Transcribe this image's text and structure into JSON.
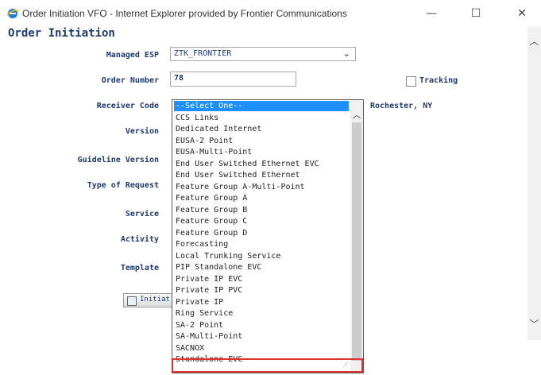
{
  "window": {
    "title": "Order Initiation VFO - Internet Explorer provided by Frontier Communications",
    "minimize": "—",
    "maximize": "☐",
    "close": "✕"
  },
  "page": {
    "heading": "Order Initiation"
  },
  "form": {
    "labels": {
      "managed_esp": "Managed ESP",
      "order_number": "Order Number",
      "receiver_code": "Receiver Code",
      "version": "Version",
      "guideline_version": "Guideline Version",
      "type_of_request": "Type of Request",
      "service": "Service",
      "activity": "Activity",
      "template": "Template"
    },
    "managed_esp_value": "ZTK_FRONTIER",
    "order_number_value": "78",
    "tracking_label": "Tracking",
    "receiver_location": "Rochester, NY",
    "initiate_label": "Initiat"
  },
  "dropdown": {
    "options": [
      "--Select One--",
      "CCS Links",
      "Dedicated Internet",
      "EUSA-2 Point",
      "EUSA-Multi-Point",
      "End User Switched Ethernet EVC",
      "End User Switched Ethernet",
      "Feature Group A-Multi-Point",
      "Feature Group A",
      "Feature Group B",
      "Feature Group C",
      "Feature Group D",
      "Forecasting",
      "Local Trunking Service",
      "PIP Standalone EVC",
      "Private IP EVC",
      "Private IP PVC",
      "Private IP",
      "Ring Service",
      "SA-2 Point",
      "SA-Multi-Point",
      "SACNOX",
      "Standalone EVC"
    ],
    "selected_index": 0
  },
  "colors": {
    "label_text": "#1f3a6e",
    "selected_bg": "#1e90ff",
    "highlight_border": "#e03030"
  }
}
